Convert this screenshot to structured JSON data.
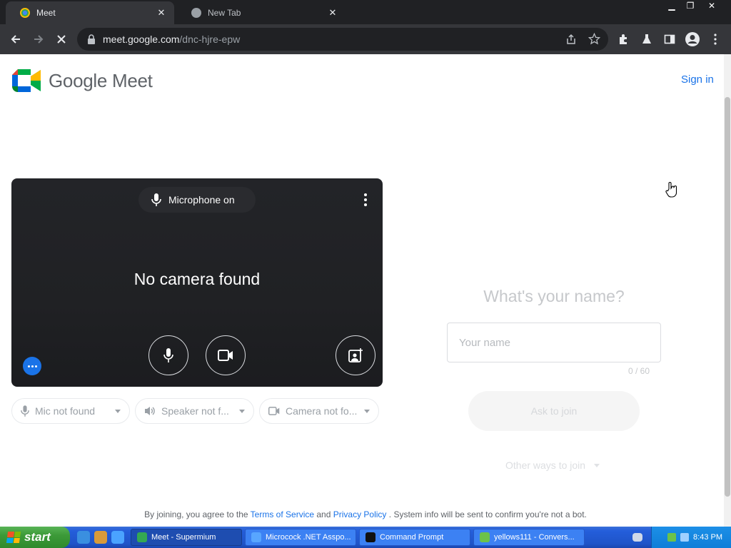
{
  "browser": {
    "tabs": [
      {
        "title": "Meet"
      },
      {
        "title": "New Tab"
      }
    ],
    "url": {
      "host": "meet.google.com",
      "path": "/dnc-hjre-epw"
    }
  },
  "header": {
    "brand": "Google Meet",
    "sign_in": "Sign in"
  },
  "preview": {
    "mic_status": "Microphone on",
    "camera_message": "No camera found"
  },
  "devices": {
    "mic": "Mic not found",
    "speaker": "Speaker not f...",
    "camera": "Camera not fo..."
  },
  "join": {
    "heading": "What's your name?",
    "name_placeholder": "Your name",
    "char_counter": "0 / 60",
    "ask_button": "Ask to join",
    "other_ways": "Other ways to join"
  },
  "footer": {
    "prefix": "By joining, you agree to the",
    "terms": "Terms of Service",
    "and": "and",
    "privacy": "Privacy Policy",
    "suffix": ". System info will be sent to confirm you're not a bot."
  },
  "taskbar": {
    "start_label": "start",
    "tasks": [
      {
        "label": "Meet - Supermium"
      },
      {
        "label": "Microcock .NET Asspo..."
      },
      {
        "label": "Command Prompt"
      },
      {
        "label": "yellows111 - Convers..."
      }
    ],
    "clock": "8:43 PM"
  },
  "colors": {
    "accent": "#1a73e8",
    "preview_bg": "#202124",
    "browser_frame": "#202124",
    "toolbar": "#35363a"
  }
}
